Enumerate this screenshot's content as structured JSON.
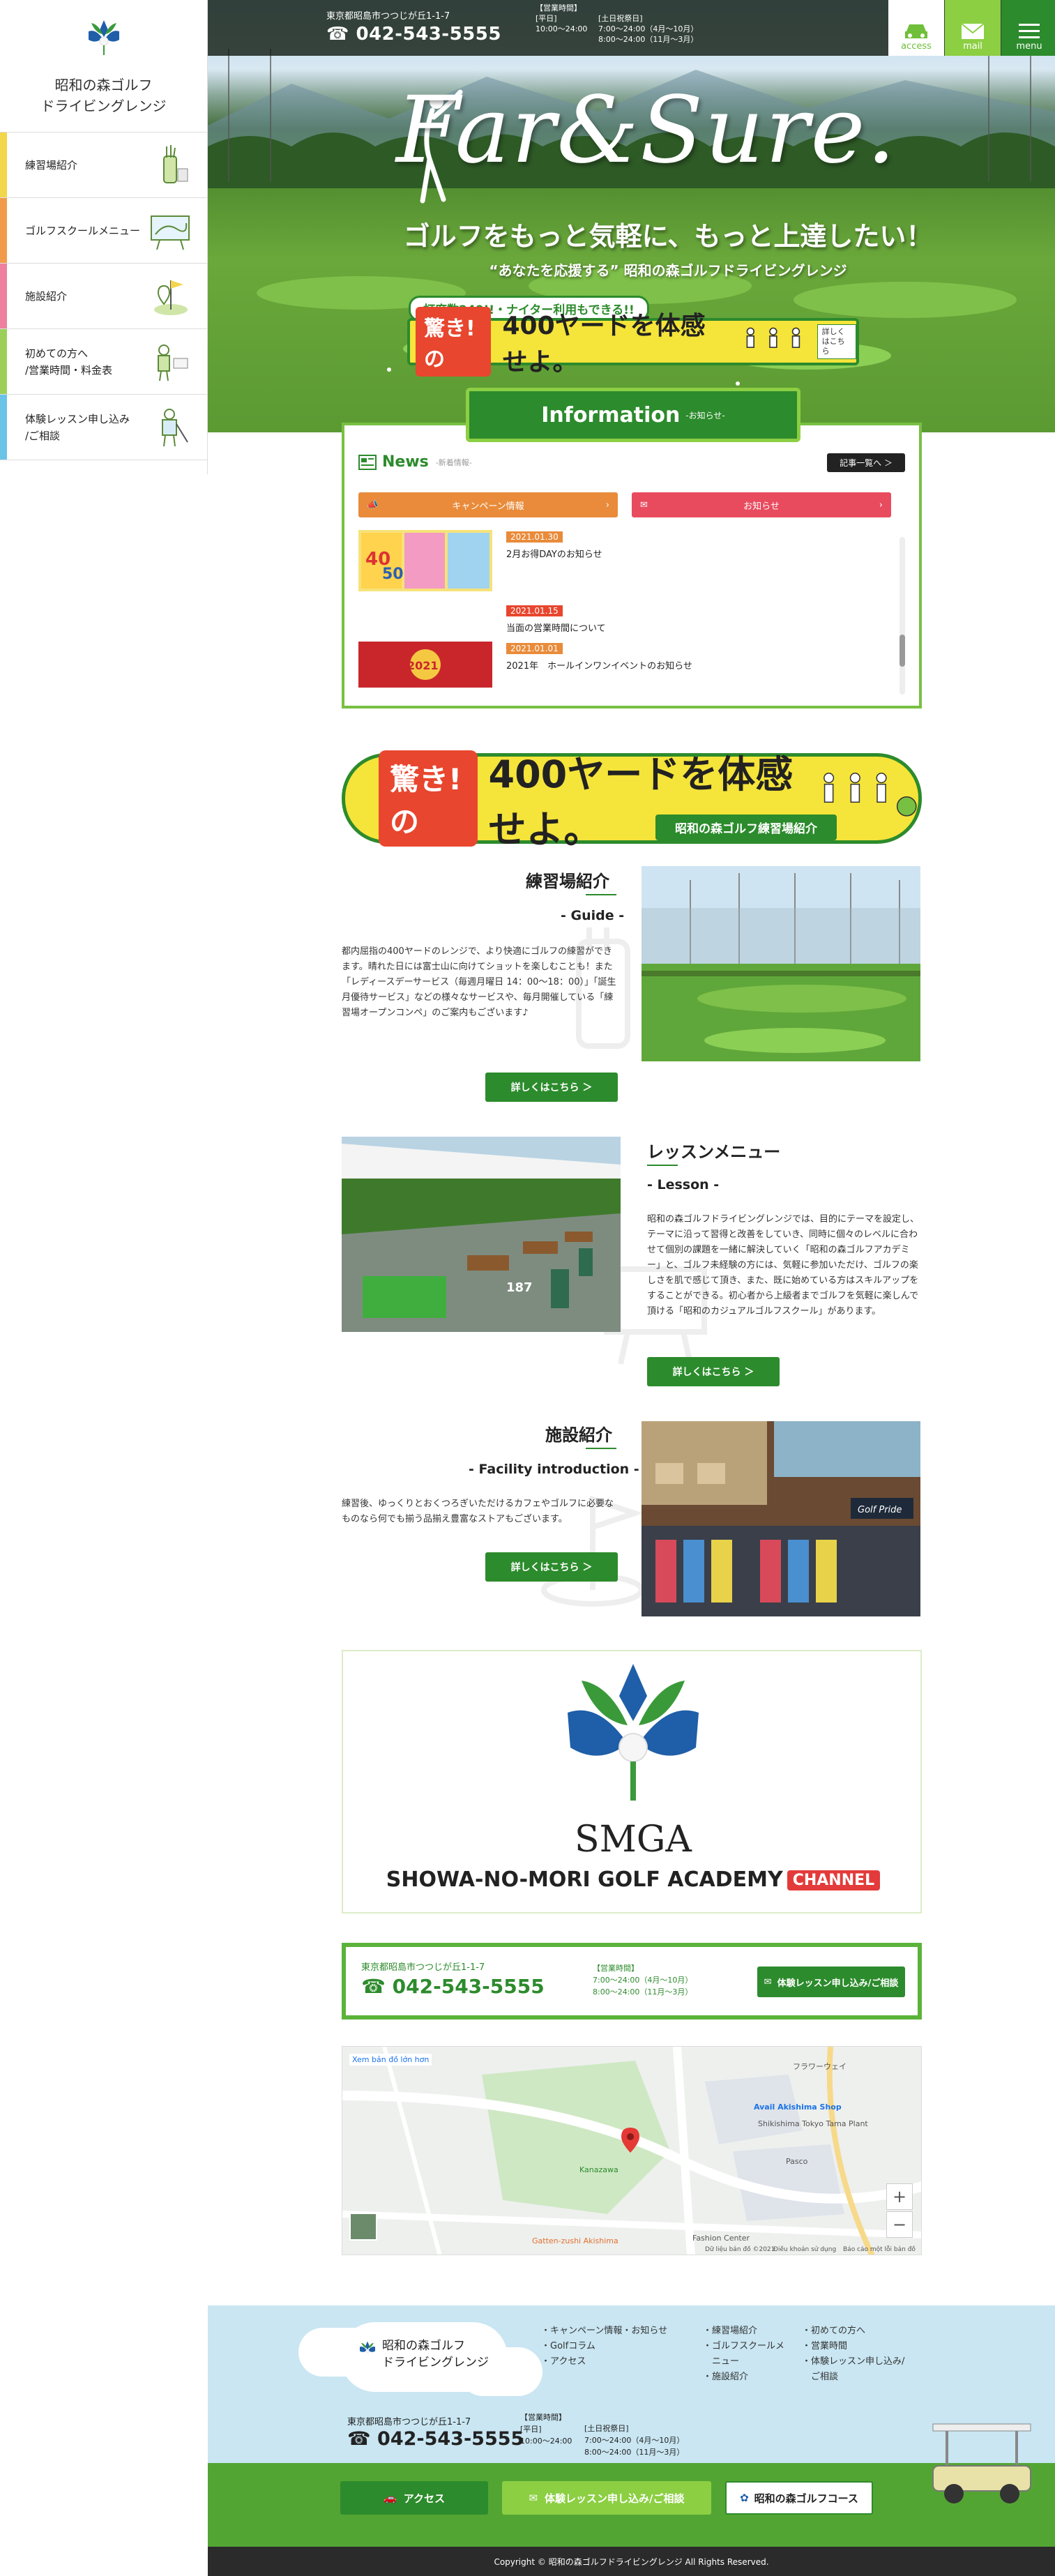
{
  "brand": {
    "name_line1": "昭和の森ゴルフ",
    "name_line2": "ドライビングレンジ",
    "primary_green": "#2c8b2c",
    "light_green": "#78c042",
    "yellow": "#f5e43a",
    "red": "#e8462e"
  },
  "sidebar": {
    "items": [
      {
        "label": "練習場紹介",
        "icon": "golf-bag-icon",
        "color": "#f2d64b"
      },
      {
        "label": "ゴルフスクールメニュー",
        "icon": "whiteboard-icon",
        "color": "#f29a4b"
      },
      {
        "label": "施設紹介",
        "icon": "flag-pin-icon",
        "color": "#ef7f9f"
      },
      {
        "label1": "初めての方へ",
        "label2": "/営業時間・料金表",
        "icon": "beginner-golfer-icon",
        "color": "#9bcf5a"
      },
      {
        "label1": "体験レッスン申し込み",
        "label2": "/ご相談",
        "icon": "coach-icon",
        "color": "#6bc3e8"
      }
    ]
  },
  "header": {
    "address": "東京都昭島市つつじが丘1-1-7",
    "phone": "042-543-5555",
    "hours_title": "【営業時間】",
    "weekday_label": "[平日]",
    "weekday_hours": "10:00〜24:00",
    "weekend_label": "[土日祝祭日]",
    "weekend_summer": "7:00〜24:00（4月〜10月）",
    "weekend_winter": "8:00〜24:00（11月〜3月）",
    "access_label": "access",
    "mail_label": "mail",
    "menu_label": "menu"
  },
  "hero": {
    "logo_text": "Far&Sure.",
    "catch": "ゴルフをもっと気軽に、もっと上達したい！",
    "sub_catch": "“あなたを応援する” 昭和の森ゴルフドライビングレンジ",
    "badge": "打席数240!!・ナイター利用もできる!!",
    "banner_red": "驚き!の",
    "banner_main": "400ヤードを体感せよ。",
    "banner_more": "詳しくはこちら"
  },
  "information": {
    "title": "Information",
    "title_sub": "-お知らせ-",
    "news_title": "News",
    "news_sub": "-新着情報-",
    "all_button": "記事一覧へ ＞",
    "tab_campaign": "キャンペーン情報",
    "tab_notice": "お知らせ",
    "items": [
      {
        "date": "2021.01.30",
        "title": "2月お得DAYのお知らせ",
        "date_color": "#e98b3a"
      },
      {
        "date": "2021.01.15",
        "title": "当面の営業時間について",
        "date_color": "#e8462e"
      },
      {
        "date": "2021.01.01",
        "title": "2021年　ホールインワンイベントのお知らせ",
        "date_color": "#e98b3a"
      }
    ]
  },
  "banner2": {
    "red": "驚き!の",
    "main": "400ヤードを体感せよ。",
    "tag": "昭和の森ゴルフ練習場紹介"
  },
  "sections": {
    "guide": {
      "title": "練習場紹介",
      "sub": "- Guide -",
      "body": "都内屈指の400ヤードのレンジで、より快適にゴルフの練習ができます。晴れた日には富士山に向けてショットを楽しむことも！また「レディースデーサービス（毎週月曜日 14：00〜18：00）」「誕生月優待サービス」などの様々なサービスや、毎月開催している「練習場オープンコンペ」のご案内もございます♪",
      "button": "詳しくはこちら ＞"
    },
    "lesson": {
      "title": "レッスンメニュー",
      "sub": "- Lesson -",
      "body": "昭和の森ゴルフドライビングレンジでは、目的にテーマを設定し、テーマに沿って習得と改善をしていき、同時に個々のレベルに合わせて個別の課題を一緒に解決していく「昭和の森ゴルフアカデミー」と、ゴルフ未経験の方には、気軽に参加いただけ、ゴルフの楽しさを肌で感じて頂き、また、既に始めている方はスキルアップをすることができる。初心者から上級者までゴルフを気軽に楽しんで頂ける「昭和のカジュアルゴルフスクール」があります。",
      "button": "詳しくはこちら ＞"
    },
    "facility": {
      "title": "施設紹介",
      "sub": "- Facility introduction -",
      "body": "練習後、ゆっくりとおくつろぎいただけるカフェやゴルフに必要なものなら何でも揃う品揃え豊富なストアもございます。",
      "button": "詳しくはこちら ＞"
    }
  },
  "smga": {
    "big": "SMGA",
    "line": "SHOWA-NO-MORI GOLF ACADEMY",
    "channel": "CHANNEL"
  },
  "contact": {
    "address": "東京都昭島市つつじが丘1-1-7",
    "phone": "042-543-5555",
    "hours_title": "【営業時間】",
    "line1": "7:00〜24:00（4月〜10月）",
    "line2": "8:00〜24:00（11月〜3月）",
    "button": "体験レッスン申し込み/ご相談"
  },
  "map": {
    "labels": [
      "Xem bản đồ lớn hơn",
      "Avail Akishima Shop",
      "Shikishima Tokyo Tama Plant",
      "Pasco",
      "Fashion Center",
      "Gatten-zushi Akishima",
      "Kanazawa",
      "フラワーウェイ",
      "Dữ liệu bản đồ ©2021",
      "Điều khoản sử dụng",
      "Báo cáo một lỗi bản đồ"
    ],
    "zoom_in": "+",
    "zoom_out": "−"
  },
  "footer": {
    "name_line1": "昭和の森ゴルフ",
    "name_line2": "ドライビングレンジ",
    "links_col1": [
      "・キャンペーン情報・お知らせ",
      "・Golfコラム",
      "・アクセス"
    ],
    "links_col2": [
      "・練習場紹介",
      "・ゴルフスクールメ",
      "　ニュー",
      "・施設紹介"
    ],
    "links_col3": [
      "・初めての方へ",
      "・営業時間",
      "・体験レッスン申し込み/",
      "　ご相談"
    ],
    "address": "東京都昭島市つつじが丘1-1-7",
    "phone": "042-543-5555",
    "hours_title": "【営業時間】",
    "weekday_label": "[平日]",
    "weekday_hours": "10:00〜24:00",
    "weekend_label": "[土日祝祭日]",
    "weekend_summer": "7:00〜24:00（4月〜10月）",
    "weekend_winter": "8:00〜24:00（11月〜3月）",
    "btn_access": "アクセス",
    "btn_lesson": "体験レッスン申し込み/ご相談",
    "btn_course": "昭和の森ゴルフコース",
    "copyright": "Copyright © 昭和の森ゴルフドライビングレンジ All Rights Reserved."
  }
}
